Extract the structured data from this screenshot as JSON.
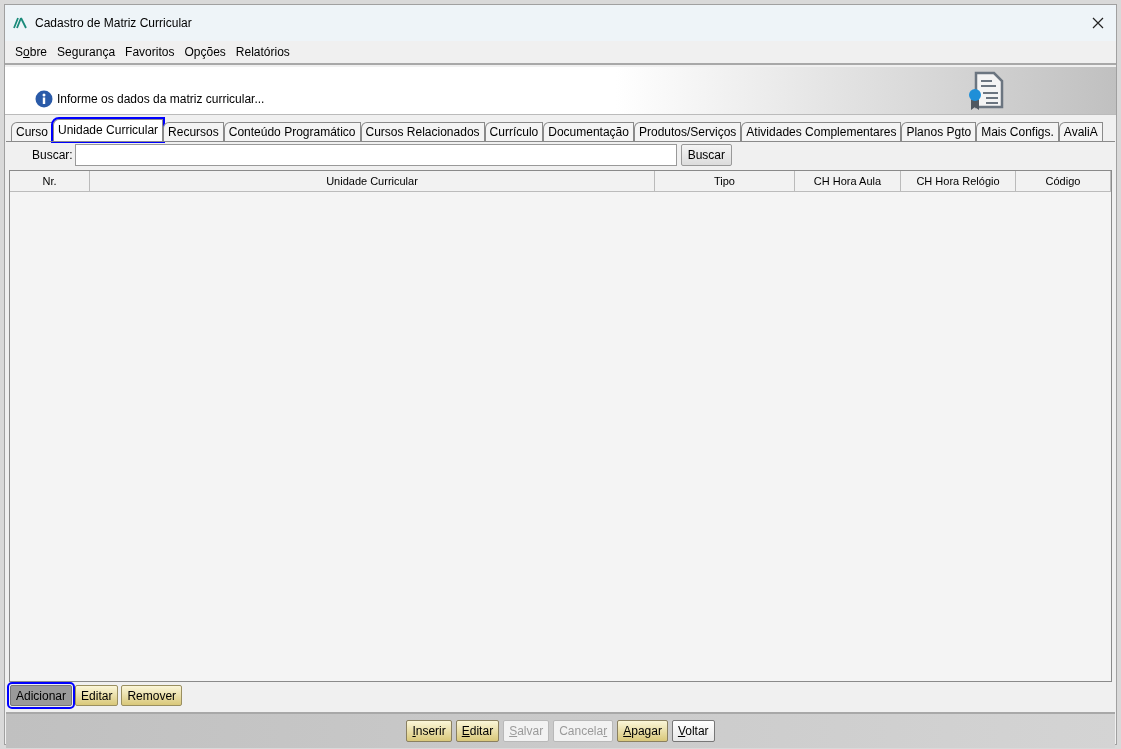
{
  "window": {
    "title": "Cadastro de Matriz Curricular"
  },
  "menu": [
    {
      "before": "S",
      "mnemonic": "o",
      "after": "bre"
    },
    {
      "after": "Segurança"
    },
    {
      "after": "Favoritos"
    },
    {
      "after": "Opções"
    },
    {
      "after": "Relatórios"
    }
  ],
  "header": {
    "message": "Informe os dados da matriz curricular..."
  },
  "tabs": [
    {
      "label": "Curso",
      "selected": false,
      "highlighted": false
    },
    {
      "label": "Unidade Curricular",
      "selected": true,
      "highlighted": true
    },
    {
      "label": "Recursos",
      "selected": false,
      "highlighted": false
    },
    {
      "label": "Conteúdo Programático",
      "selected": false,
      "highlighted": false
    },
    {
      "label": "Cursos Relacionados",
      "selected": false,
      "highlighted": false
    },
    {
      "label": "Currículo",
      "selected": false,
      "highlighted": false
    },
    {
      "label": "Documentação",
      "selected": false,
      "highlighted": false
    },
    {
      "label": "Produtos/Serviços",
      "selected": false,
      "highlighted": false
    },
    {
      "label": "Atividades Complementares",
      "selected": false,
      "highlighted": false
    },
    {
      "label": "Planos Pgto",
      "selected": false,
      "highlighted": false
    },
    {
      "label": "Mais Configs.",
      "selected": false,
      "highlighted": false
    },
    {
      "label": "AvaliA",
      "selected": false,
      "highlighted": false
    }
  ],
  "search": {
    "label": "Buscar:",
    "button": "Buscar"
  },
  "table": {
    "columns": [
      "Nr.",
      "Unidade Curricular",
      "Tipo",
      "CH Hora Aula",
      "CH Hora Relógio",
      "Código"
    ]
  },
  "table_buttons": [
    {
      "label": "Adicionar",
      "highlighted": true,
      "pressed": true
    },
    {
      "label": "Editar",
      "highlighted": false,
      "pressed": false
    },
    {
      "label": "Remover",
      "highlighted": false,
      "pressed": false
    }
  ],
  "footer_buttons": [
    {
      "mnemonic": "I",
      "after": "nserir",
      "disabled": false,
      "kind": "accent"
    },
    {
      "mnemonic": "E",
      "after": "ditar",
      "disabled": false,
      "kind": "accent"
    },
    {
      "mnemonic": "S",
      "after": "alvar",
      "disabled": true,
      "kind": "accent"
    },
    {
      "before": "Cancela",
      "mnemonic": "r",
      "disabled": true,
      "kind": "accent"
    },
    {
      "mnemonic": "A",
      "after": "pagar",
      "disabled": false,
      "kind": "accent"
    },
    {
      "mnemonic": "V",
      "after": "oltar",
      "disabled": false,
      "kind": "plain"
    }
  ]
}
